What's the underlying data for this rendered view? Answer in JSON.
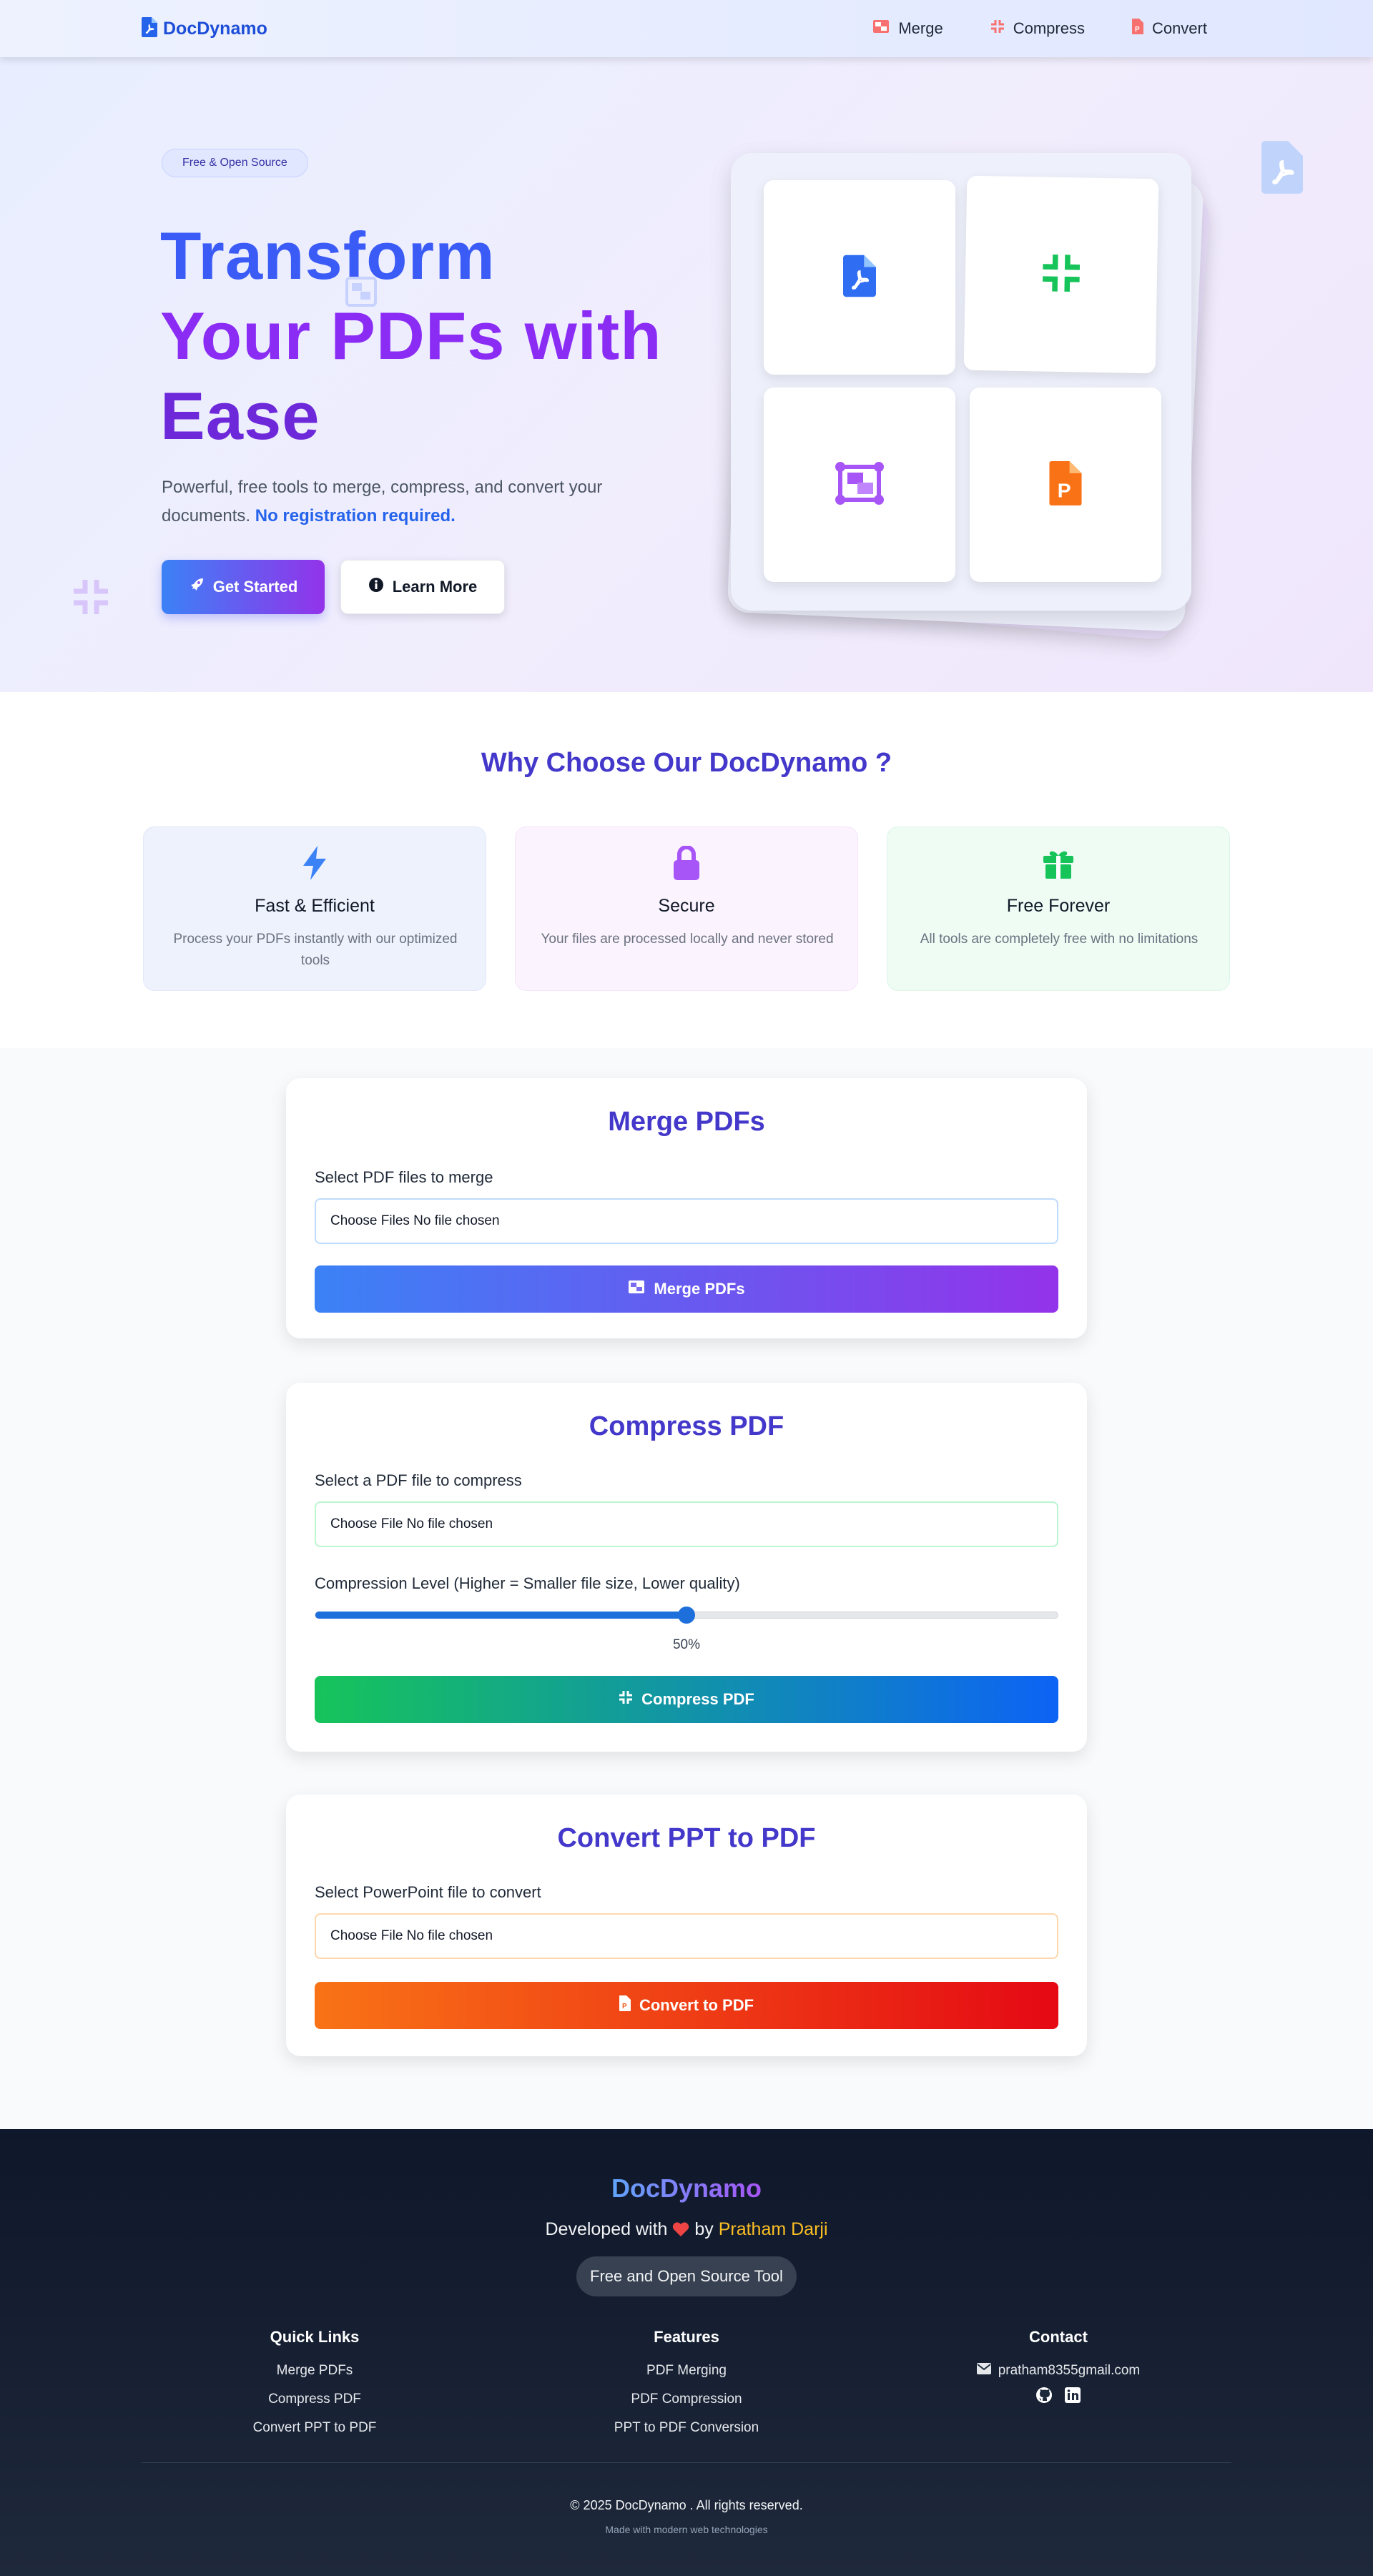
{
  "nav": {
    "brand": "DocDynamo",
    "links": [
      {
        "label": "Merge",
        "icon": "merge-icon"
      },
      {
        "label": "Compress",
        "icon": "compress-icon"
      },
      {
        "label": "Convert",
        "icon": "convert-icon"
      }
    ]
  },
  "hero": {
    "badge": "Free & Open Source",
    "title_line1": "Transform",
    "title_line2": "Your PDFs with",
    "title_line3": "Ease",
    "desc": "Powerful, free tools to merge, compress, and convert your documents.",
    "desc_accent": "No registration required.",
    "primary_button": "Get Started",
    "secondary_button": "Learn More"
  },
  "why": {
    "title": "Why Choose Our DocDynamo ?",
    "features": [
      {
        "title": "Fast & Efficient",
        "desc": "Process your PDFs instantly with our optimized tools",
        "icon": "bolt-icon"
      },
      {
        "title": "Secure",
        "desc": "Your files are processed locally and never stored",
        "icon": "lock-icon"
      },
      {
        "title": "Free Forever",
        "desc": "All tools are completely free with no limitations",
        "icon": "gift-icon"
      }
    ]
  },
  "merge": {
    "title": "Merge PDFs",
    "label": "Select PDF files to merge",
    "input": "Choose Files No file chosen",
    "button": "Merge PDFs"
  },
  "compress": {
    "title": "Compress PDF",
    "label": "Select a PDF file to compress",
    "input": "Choose File No file chosen",
    "level_label": "Compression Level (Higher = Smaller file size, Lower quality)",
    "level_value": 50,
    "level_text": "50%",
    "button": "Compress PDF"
  },
  "convert": {
    "title": "Convert PPT to PDF",
    "label": "Select PowerPoint file to convert",
    "input": "Choose File No file chosen",
    "button": "Convert to PDF"
  },
  "colors": {
    "brand": "#1d4ed8",
    "accent": "#4338ca",
    "merge_gradient": [
      "#3b82f6",
      "#9333ea"
    ],
    "compress_gradient": [
      "#16c45a",
      "#0d63f5"
    ],
    "convert_gradient": [
      "#f97316",
      "#e50914"
    ]
  },
  "footer": {
    "brand": "DocDynamo",
    "dev_prefix": "Developed with",
    "dev_by": "by",
    "author": "Pratham Darji",
    "pill": "Free and Open Source Tool",
    "quick_links_title": "Quick Links",
    "quick_links": [
      "Merge PDFs",
      "Compress PDF",
      "Convert PPT to PDF"
    ],
    "features_title": "Features",
    "features": [
      "PDF Merging",
      "PDF Compression",
      "PPT to PDF Conversion"
    ],
    "contact_title": "Contact",
    "email": "pratham8355gmail.com",
    "copyright": "© 2025 DocDynamo . All rights reserved.",
    "made_with": "Made with modern web technologies"
  }
}
